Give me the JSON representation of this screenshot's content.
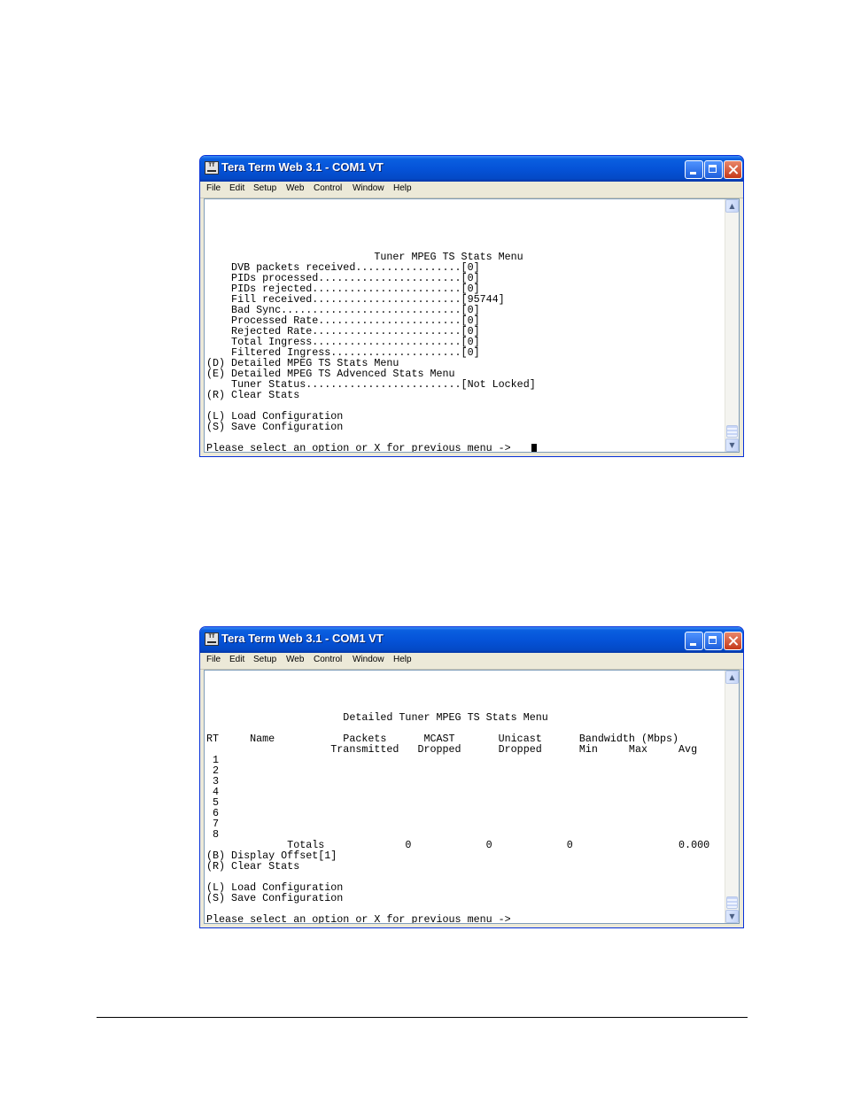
{
  "window_title": "Tera Term Web 3.1 - COM1 VT",
  "app_icon_text": "TT",
  "menu_items": [
    "File",
    "Edit",
    "Setup",
    "Web",
    "Control",
    "Window",
    "Help"
  ],
  "screen1": {
    "lines": [
      "                           Tuner MPEG TS Stats Menu",
      "    DVB packets received.................[0]",
      "    PIDs processed.......................[0]",
      "    PIDs rejected........................[0]",
      "    Fill received........................[95744]",
      "    Bad Sync.............................[0]",
      "    Processed Rate.......................[0]",
      "    Rejected Rate........................[0]",
      "    Total Ingress........................[0]",
      "    Filtered Ingress.....................[0]",
      "(D) Detailed MPEG TS Stats Menu",
      "(E) Detailed MPEG TS Advenced Stats Menu",
      "    Tuner Status.........................[Not Locked]",
      "(R) Clear Stats",
      "",
      "(L) Load Configuration",
      "(S) Save Configuration",
      "Please select an option or X for previous menu -> "
    ]
  },
  "screen2": {
    "lines": [
      "                      Detailed Tuner MPEG TS Stats Menu",
      "",
      "RT     Name           Packets      MCAST       Unicast      Bandwidth (Mbps)",
      "                    Transmitted   Dropped      Dropped      Min     Max     Avg",
      " 1",
      " 2",
      " 3",
      " 4",
      " 5",
      " 6",
      " 7",
      " 8",
      "             Totals             0            0            0                 0.000",
      "(B) Display Offset[1]",
      "(R) Clear Stats",
      "",
      "(L) Load Configuration",
      "(S) Save Configuration",
      "Please select an option or X for previous menu ->"
    ]
  }
}
